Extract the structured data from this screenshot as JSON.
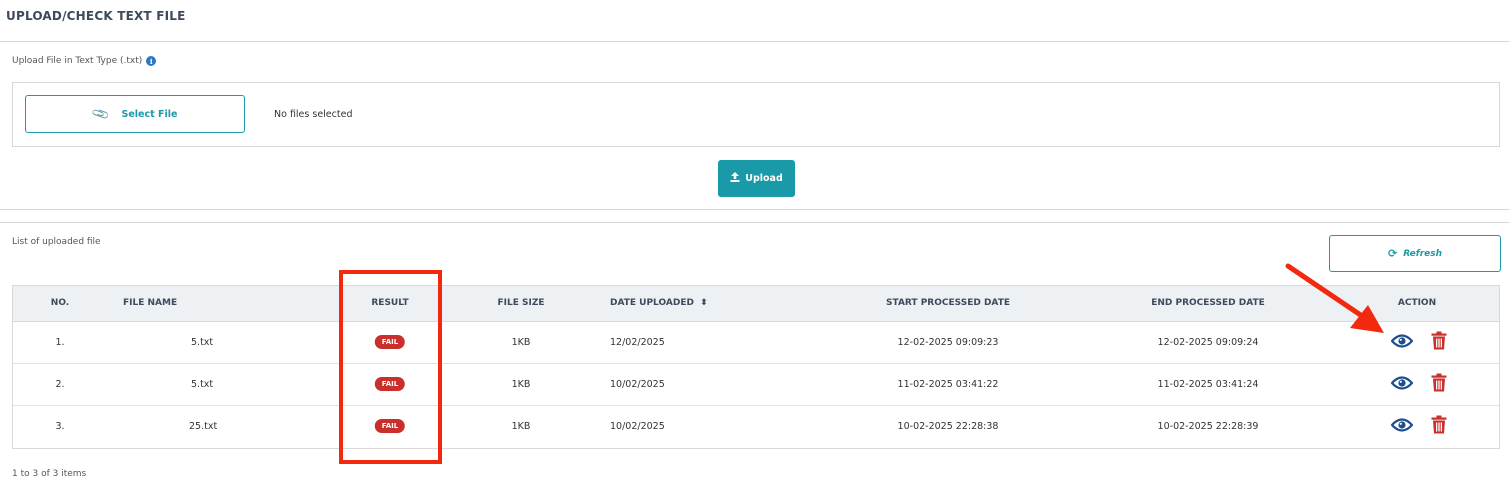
{
  "page": {
    "title": "UPLOAD/CHECK TEXT FILE",
    "upload_label": "Upload File in Text Type (.txt)",
    "info_icon": "i",
    "select_file_label": "Select File",
    "no_files_text": "No files selected",
    "upload_label_btn": "Upload",
    "list_label": "List of uploaded file",
    "refresh_label": "Refresh",
    "pagination_text": "1 to 3 of 3 items"
  },
  "icons": {
    "info": "info-icon",
    "paperclip": "paperclip-icon",
    "upload": "upload-icon",
    "refresh": "refresh-icon",
    "sort": "sort-icon",
    "view": "eye-icon",
    "delete": "trash-icon"
  },
  "colors": {
    "accent": "#1a9aa8",
    "fail_badge": "#c9302c",
    "view_icon": "#1f4e8c",
    "delete_icon": "#c9302c",
    "annotation": "#f2290f"
  },
  "table": {
    "columns": {
      "no": "NO.",
      "file_name": "FILE NAME",
      "result": "RESULT",
      "file_size": "FILE SIZE",
      "date_uploaded": "DATE UPLOADED",
      "sort_glyph": "⬍",
      "start_processed": "START PROCESSED DATE",
      "end_processed": "END PROCESSED DATE",
      "action": "ACTION"
    },
    "rows": [
      {
        "no": "1.",
        "file_name": "5.txt",
        "result": "FAIL",
        "file_size": "1KB",
        "date_uploaded": "12/02/2025",
        "start": "12-02-2025 09:09:23",
        "end": "12-02-2025 09:09:24"
      },
      {
        "no": "2.",
        "file_name": "5.txt",
        "result": "FAIL",
        "file_size": "1KB",
        "date_uploaded": "10/02/2025",
        "start": "11-02-2025 03:41:22",
        "end": "11-02-2025 03:41:24"
      },
      {
        "no": "3.",
        "file_name": "25.txt",
        "result": "FAIL",
        "file_size": "1KB",
        "date_uploaded": "10/02/2025",
        "start": "10-02-2025 22:28:38",
        "end": "10-02-2025 22:28:39"
      }
    ]
  }
}
